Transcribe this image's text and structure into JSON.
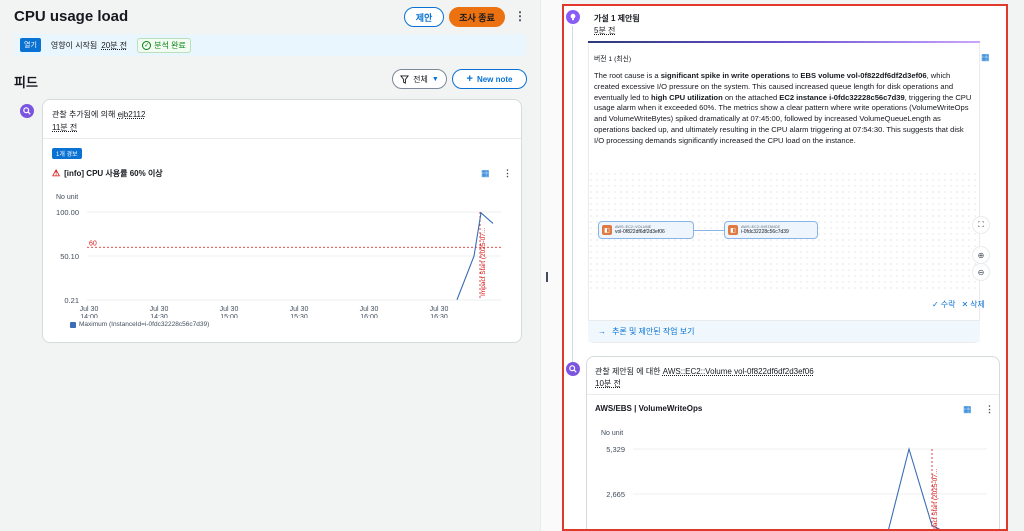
{
  "header": {
    "title": "CPU usage load",
    "propose_label": "제안",
    "end_label": "조사 종료",
    "more_icon": "kebab-icon"
  },
  "status": {
    "badge": "열기",
    "text": "영향이 시작됨",
    "time": "20분 전",
    "complete": "분석 완료"
  },
  "feed": {
    "title": "피드",
    "filter_label": "전체",
    "new_note_label": "New note"
  },
  "left_card": {
    "meta_prefix": "관찰 추가됨에 의해",
    "meta_user": "ejb2112",
    "meta_time": "11분 전",
    "count_badge": "1개 경보",
    "alarm_title": "[info] CPU 사용률 60% 이상",
    "unit": "No unit",
    "threshold_label": "60",
    "impact_label": "Impact Start (2025-07...",
    "legend": "Maximum (InstanceId=i-0fdc32228c56c7d39)",
    "chart_data": {
      "type": "line",
      "ylabel": "No unit",
      "yticks": [
        "100.00",
        "50.10",
        "0.21"
      ],
      "xticks": [
        "Jul 30\n14:00",
        "Jul 30\n14:30",
        "Jul 30\n15:00",
        "Jul 30\n15:30",
        "Jul 30\n16:00",
        "Jul 30\n16:30"
      ],
      "xtick_lines": [
        [
          "Jul 30",
          "14:00"
        ],
        [
          "Jul 30",
          "14:30"
        ],
        [
          "Jul 30",
          "15:00"
        ],
        [
          "Jul 30",
          "15:30"
        ],
        [
          "Jul 30",
          "16:00"
        ],
        [
          "Jul 30",
          "16:30"
        ]
      ],
      "ylim": [
        0.21,
        100
      ],
      "threshold": 60,
      "series": [
        {
          "name": "Maximum (InstanceId=i-0fdc32228c56c7d39)",
          "x": [
            "16:34",
            "16:39",
            "16:41",
            "16:44"
          ],
          "values": [
            0.5,
            50,
            99,
            87
          ]
        }
      ]
    }
  },
  "hypothesis": {
    "title": "가설 1 제안됨",
    "time": "5분 전",
    "version": "버전 1 (최신)",
    "text_1": "The root cause is a ",
    "bold_1": "significant spike in write operations",
    "text_2": " to ",
    "bold_2": "EBS volume vol-0f822df6df2d3ef06",
    "text_3": ", which created excessive I/O pressure on the system. This caused increased queue length for disk operations and eventually led to ",
    "bold_3": "high CPU utilization",
    "text_4": " on the attached ",
    "bold_4": "EC2 instance i-0fdc32228c56c7d39",
    "text_5": ", triggering the CPU usage alarm when it exceeded 60%. The metrics show a clear pattern where write operations (VolumeWriteOps and VolumeWriteBytes) spiked dramatically at 07:45:00, followed by increased VolumeQueueLength as operations backed up, and ultimately resulting in the CPU alarm triggering at 07:54:30. This suggests that disk I/O processing demands significantly increased the CPU load on the instance.",
    "node1_type": "AWS::EC2::VOLUME",
    "node1_name": "vol-0f822df6df2d3ef06",
    "node2_type": "AWS::EC2::INSTANCE",
    "node2_name": "i-0fdc32228c56c7d39",
    "edit_label": "수락",
    "delete_label": "삭제",
    "footer_link": "추론 및 제안된 작업 보기"
  },
  "obs_card": {
    "meta_prefix": "관찰 제안됨 에 대한",
    "meta_target": "AWS::EC2::Volume vol-0f822df6df2d3ef06",
    "meta_time": "10분 전",
    "chart_title": "AWS/EBS | VolumeWriteOps",
    "unit": "No unit",
    "impact_label": "Impact Start (2025-07...",
    "chart_data": {
      "type": "line",
      "ylabel": "No unit",
      "yticks": [
        "5,329",
        "2,665"
      ],
      "series": [
        {
          "name": "",
          "x": [
            1,
            2,
            3,
            4,
            5,
            6,
            7
          ],
          "values": [
            0,
            200,
            5329,
            800,
            300,
            100,
            0
          ]
        }
      ]
    }
  },
  "colors": {
    "accent": "#0972d3",
    "alert": "#d91515",
    "end_button": "#ec7211",
    "highlight_border": "#e0392b"
  }
}
